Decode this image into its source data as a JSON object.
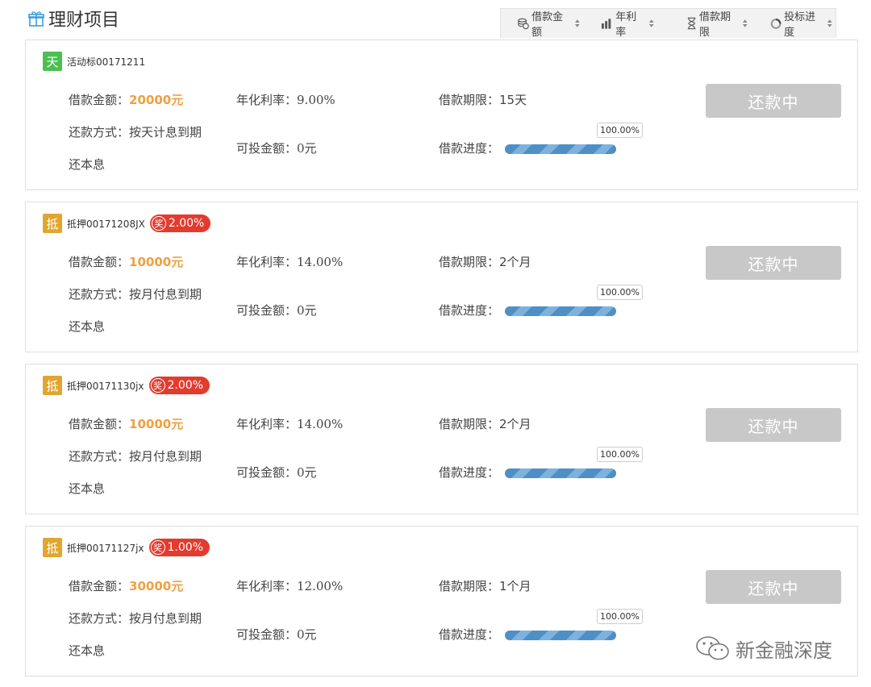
{
  "header": {
    "title": "理财项目"
  },
  "sort_options": [
    {
      "label": "借款金额",
      "icon": "coins-icon"
    },
    {
      "label": "年利率",
      "icon": "bar-chart-icon"
    },
    {
      "label": "借款期限",
      "icon": "hourglass-icon"
    },
    {
      "label": "投标进度",
      "icon": "progress-ring-icon"
    }
  ],
  "labels": {
    "amount": "借款金额：",
    "rate": "年化利率：",
    "term": "借款期限：",
    "method": "还款方式：",
    "available": "可投金额：",
    "progress": "借款进度："
  },
  "colors": {
    "amount": "#f0a040",
    "reward": "#e33b2e",
    "badge_tian": "#4cbf50",
    "badge_di": "#e0a630",
    "button_disabled": "#c8c8c8",
    "progress": "#4f8fc6"
  },
  "cards": [
    {
      "badge": "天",
      "badge_color": "#4cbf50",
      "name": "活动标00171211",
      "reward": "",
      "amount": "20000元",
      "rate": "9.00%",
      "term": "15天",
      "method_line1": "按天计息到期",
      "method_line2": "还本息",
      "available": "0元",
      "progress_text": "100.00%",
      "progress": 1.0,
      "status": "还款中"
    },
    {
      "badge": "抵",
      "badge_color": "#e0a630",
      "name": "抵押00171208JX",
      "reward_icon": "奖",
      "reward": "2.00%",
      "amount": "10000元",
      "rate": "14.00%",
      "term": "2个月",
      "method_line1": "按月付息到期",
      "method_line2": "还本息",
      "available": "0元",
      "progress_text": "100.00%",
      "progress": 1.0,
      "status": "还款中"
    },
    {
      "badge": "抵",
      "badge_color": "#e0a630",
      "name": "抵押00171130jx",
      "reward_icon": "奖",
      "reward": "2.00%",
      "amount": "10000元",
      "rate": "14.00%",
      "term": "2个月",
      "method_line1": "按月付息到期",
      "method_line2": "还本息",
      "available": "0元",
      "progress_text": "100.00%",
      "progress": 1.0,
      "status": "还款中"
    },
    {
      "badge": "抵",
      "badge_color": "#e0a630",
      "name": "抵押00171127jx",
      "reward_icon": "奖",
      "reward": "1.00%",
      "amount": "30000元",
      "rate": "12.00%",
      "term": "1个月",
      "method_line1": "按月付息到期",
      "method_line2": "还本息",
      "available": "0元",
      "progress_text": "100.00%",
      "progress": 1.0,
      "status": "还款中"
    }
  ],
  "watermark": {
    "text": "新金融深度",
    "icon": "wechat-icon"
  }
}
